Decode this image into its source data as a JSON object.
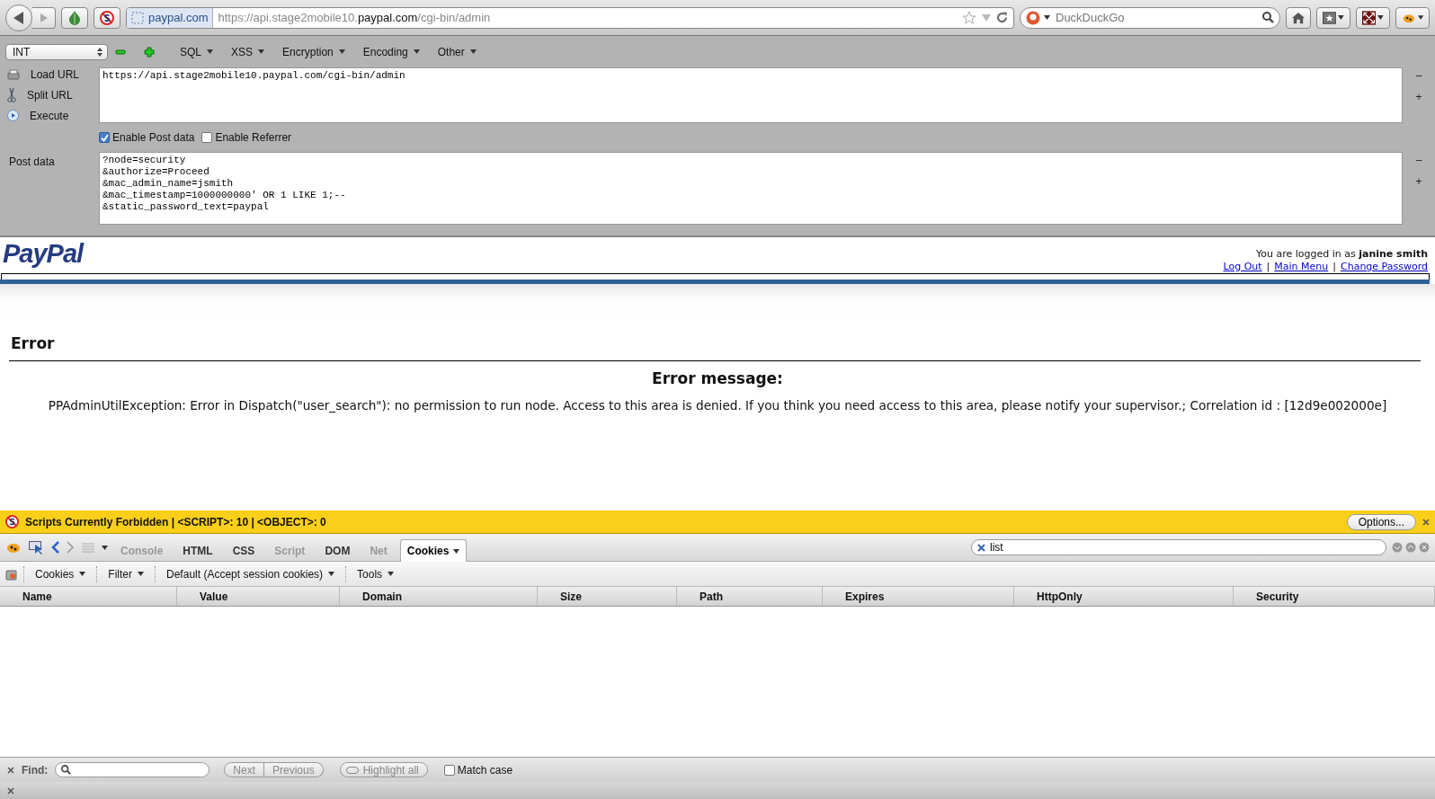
{
  "browser_toolbar": {
    "site_identity": "paypal.com",
    "url": "https://api.stage2mobile10.**paypal.com**/cgi-bin/admin",
    "search": {
      "placeholder": "DuckDuckGo"
    }
  },
  "hackbar": {
    "select_value": "INT",
    "menus": [
      "SQL",
      "XSS",
      "Encryption",
      "Encoding",
      "Other"
    ],
    "actions": [
      {
        "kind": "load",
        "label": "Load URL"
      },
      {
        "kind": "split",
        "label": "Split URL"
      },
      {
        "kind": "execute",
        "label": "Execute"
      }
    ],
    "url": "https://api.stage2mobile10.paypal.com/cgi-bin/admin",
    "resize_buttons": [
      "–",
      "+"
    ],
    "options": [
      {
        "label": "Enable Post data",
        "checked": true
      },
      {
        "label": "Enable Referrer",
        "checked": false
      }
    ],
    "post_label": "Post data",
    "post_data": "?node=security\n&authorize=Proceed\n&mac_admin_name=jsmith\n&mac_timestamp=1000000000' OR 1 LIKE 1;--\n&static_password_text=paypal",
    "post_resize_buttons": [
      "–",
      "+"
    ]
  },
  "page": {
    "logo": "PayPal",
    "login_text": "You are logged in as **janine smith**",
    "links": [
      "Log Out",
      "Main Menu",
      "Change Password"
    ],
    "link_separator": "|",
    "heading": "Error",
    "subheading": "Error message:",
    "message": "PPAdminUtilException: Error in Dispatch(\"user_search\"): no permission to run node. Access to this area is denied. If you think you need access to this area, please notify your supervisor.; Correlation id : [12d9e002000e]"
  },
  "noscript_bar": {
    "text": "Scripts Currently Forbidden | <SCRIPT>: 10 | <OBJECT>: 0",
    "button": "Options..."
  },
  "firebug": {
    "tabs": [
      {
        "label": "Console",
        "selected": false,
        "disabled": true
      },
      {
        "label": "HTML",
        "selected": false,
        "disabled": false
      },
      {
        "label": "CSS",
        "selected": false,
        "disabled": false
      },
      {
        "label": "Script",
        "selected": false,
        "disabled": true
      },
      {
        "label": "DOM",
        "selected": false,
        "disabled": false
      },
      {
        "label": "Net",
        "selected": false,
        "disabled": true
      },
      {
        "label": "Cookies",
        "selected": true,
        "disabled": false
      }
    ],
    "search_value": "list",
    "menus": [
      "Cookies",
      "Filter",
      "Default (Accept session cookies)",
      "Tools"
    ],
    "columns": [
      "Name",
      "Value",
      "Domain",
      "Size",
      "Path",
      "Expires",
      "HttpOnly",
      "Security"
    ]
  },
  "find_bar": {
    "label": "Find:",
    "buttons": [
      {
        "label": "Next",
        "disabled": true
      },
      {
        "label": "Previous",
        "disabled": true
      }
    ],
    "highlight": "Highlight all",
    "match_case": {
      "label": "Match case",
      "checked": false
    }
  }
}
